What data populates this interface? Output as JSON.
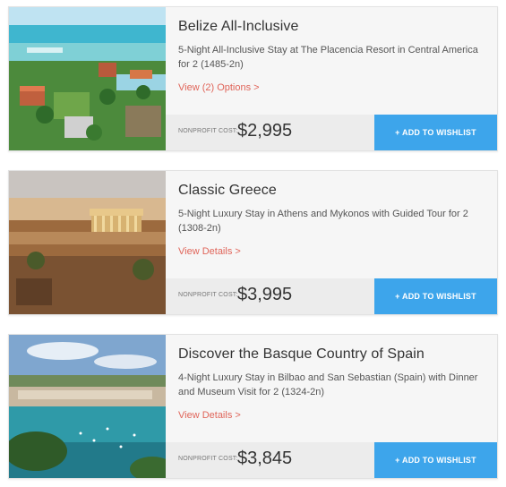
{
  "listings": [
    {
      "title": "Belize All-Inclusive",
      "description": "5-Night All-Inclusive Stay at The Placencia Resort in Central America for 2 (1485-2n)",
      "link_label": "View (2) Options >",
      "price_label": "NONPROFIT COST:",
      "price": "$2,995",
      "button_label": "+ ADD TO WISHLIST"
    },
    {
      "title": "Classic Greece",
      "description": "5-Night Luxury Stay in Athens and Mykonos with Guided Tour for 2 (1308-2n)",
      "link_label": "View Details >",
      "price_label": "NONPROFIT COST:",
      "price": "$3,995",
      "button_label": "+ ADD TO WISHLIST"
    },
    {
      "title": "Discover the Basque Country of Spain",
      "description": "4-Night Luxury Stay in Bilbao and San Sebastian (Spain) with Dinner and Museum Visit for 2 (1324-2n)",
      "link_label": "View Details >",
      "price_label": "NONPROFIT COST:",
      "price": "$3,845",
      "button_label": "+ ADD TO WISHLIST"
    }
  ],
  "colors": {
    "link": "#e0655a",
    "button": "#3da5eb",
    "price_bar": "#ececec"
  }
}
